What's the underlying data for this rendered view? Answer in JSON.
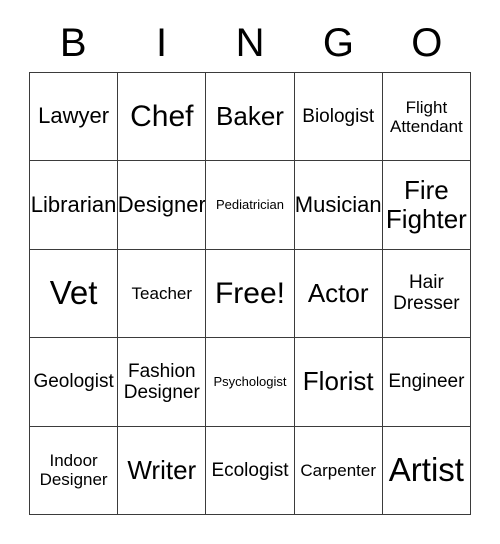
{
  "header": {
    "letters": [
      "B",
      "I",
      "N",
      "G",
      "O"
    ]
  },
  "grid": {
    "columns": 5,
    "rows": 5,
    "border_color": "#3b3b3b",
    "background_color": "#ffffff",
    "text_color": "#000000",
    "cells": [
      {
        "label": "Lawyer",
        "size": "fs-lg",
        "row": 1,
        "col": 1
      },
      {
        "label": "Chef",
        "size": "fs-2xl",
        "row": 1,
        "col": 2
      },
      {
        "label": "Baker",
        "size": "fs-xl",
        "row": 1,
        "col": 3
      },
      {
        "label": "Biologist",
        "size": "fs-md",
        "row": 1,
        "col": 4
      },
      {
        "label": "Flight\nAttendant",
        "size": "fs-sm",
        "row": 1,
        "col": 5
      },
      {
        "label": "Librarian",
        "size": "fs-lg",
        "row": 2,
        "col": 1
      },
      {
        "label": "Designer",
        "size": "fs-lg",
        "row": 2,
        "col": 2
      },
      {
        "label": "Pediatrician",
        "size": "fs-xs",
        "row": 2,
        "col": 3
      },
      {
        "label": "Musician",
        "size": "fs-lg",
        "row": 2,
        "col": 4
      },
      {
        "label": "Fire\nFighter",
        "size": "fs-xl",
        "row": 2,
        "col": 5
      },
      {
        "label": "Vet",
        "size": "fs-3xl",
        "row": 3,
        "col": 1
      },
      {
        "label": "Teacher",
        "size": "fs-sm",
        "row": 3,
        "col": 2
      },
      {
        "label": "Free!",
        "size": "fs-2xl",
        "row": 3,
        "col": 3
      },
      {
        "label": "Actor",
        "size": "fs-xl",
        "row": 3,
        "col": 4
      },
      {
        "label": "Hair\nDresser",
        "size": "fs-md",
        "row": 3,
        "col": 5
      },
      {
        "label": "Geologist",
        "size": "fs-md",
        "row": 4,
        "col": 1
      },
      {
        "label": "Fashion\nDesigner",
        "size": "fs-md",
        "row": 4,
        "col": 2
      },
      {
        "label": "Psychologist",
        "size": "fs-xs",
        "row": 4,
        "col": 3
      },
      {
        "label": "Florist",
        "size": "fs-xl",
        "row": 4,
        "col": 4
      },
      {
        "label": "Engineer",
        "size": "fs-md",
        "row": 4,
        "col": 5
      },
      {
        "label": "Indoor\nDesigner",
        "size": "fs-sm",
        "row": 5,
        "col": 1
      },
      {
        "label": "Writer",
        "size": "fs-xl",
        "row": 5,
        "col": 2
      },
      {
        "label": "Ecologist",
        "size": "fs-md",
        "row": 5,
        "col": 3
      },
      {
        "label": "Carpenter",
        "size": "fs-sm",
        "row": 5,
        "col": 4
      },
      {
        "label": "Artist",
        "size": "fs-3xl",
        "row": 5,
        "col": 5
      }
    ]
  }
}
